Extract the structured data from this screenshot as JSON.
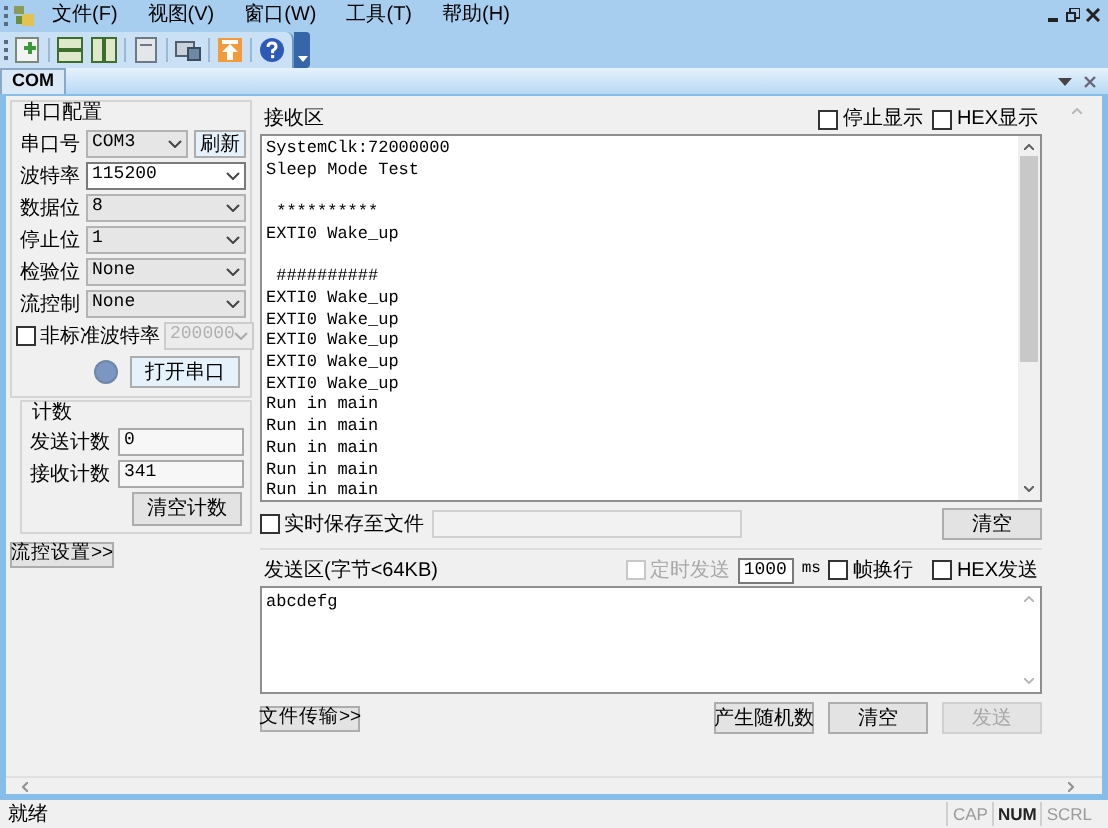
{
  "menu": [
    "文件(F)",
    "视图(V)",
    "窗口(W)",
    "工具(T)",
    "帮助(H)"
  ],
  "tabs": [
    {
      "label": "COM",
      "selected": true
    }
  ],
  "serial_config": {
    "title": "串口配置",
    "refresh_button": "刷新",
    "fields": [
      {
        "label": "串口号",
        "value": "COM3",
        "highlighted": false
      },
      {
        "label": "波特率",
        "value": "115200",
        "highlighted": true
      },
      {
        "label": "数据位",
        "value": "8",
        "highlighted": false
      },
      {
        "label": "停止位",
        "value": "1",
        "highlighted": false
      },
      {
        "label": "检验位",
        "value": "None",
        "highlighted": false
      },
      {
        "label": "流控制",
        "value": "None",
        "highlighted": false
      }
    ],
    "nonstandard_baud": {
      "label": "非标准波特率",
      "checked": false,
      "value": "200000",
      "disabled": true
    },
    "port_led": {
      "on": false
    },
    "open_button": "打开串口"
  },
  "counts": {
    "title": "计数",
    "rows": [
      {
        "label": "发送计数",
        "value": "0"
      },
      {
        "label": "接收计数",
        "value": "341"
      }
    ],
    "clear_button": "清空计数"
  },
  "flow_button": "流控设置>>",
  "receive": {
    "title": "接收区",
    "options": [
      {
        "label": "停止显示",
        "checked": false
      },
      {
        "label": "HEX显示",
        "checked": false
      }
    ],
    "text": "SystemClk:72000000\nSleep Mode Test\n\n **********\nEXTI0 Wake_up\n\n ##########\nEXTI0 Wake_up\nEXTI0 Wake_up\nEXTI0 Wake_up\nEXTI0 Wake_up\nEXTI0 Wake_up\nRun in main\nRun in main\nRun in main\nRun in main\nRun in main",
    "save_to_file": {
      "label": "实时保存至文件",
      "checked": false
    },
    "clear_button": "清空"
  },
  "send": {
    "title": "发送区(字节<64KB)",
    "timed": {
      "label": "定时发送",
      "checked": false,
      "disabled": true
    },
    "interval": "1000",
    "unit": "ms",
    "options": [
      {
        "label": "帧换行",
        "checked": false
      },
      {
        "label": "HEX发送",
        "checked": false
      }
    ],
    "text": "abcdefg",
    "buttons": [
      {
        "label": "文件传输>>",
        "disabled": false
      },
      {
        "label": "产生随机数",
        "disabled": false
      },
      {
        "label": "清空",
        "disabled": false
      },
      {
        "label": "发送",
        "disabled": true
      }
    ]
  },
  "status_bar": {
    "text": "就绪",
    "indicators": [
      {
        "label": "CAP",
        "on": false
      },
      {
        "label": "NUM",
        "on": true
      },
      {
        "label": "SCRL",
        "on": false
      }
    ]
  }
}
